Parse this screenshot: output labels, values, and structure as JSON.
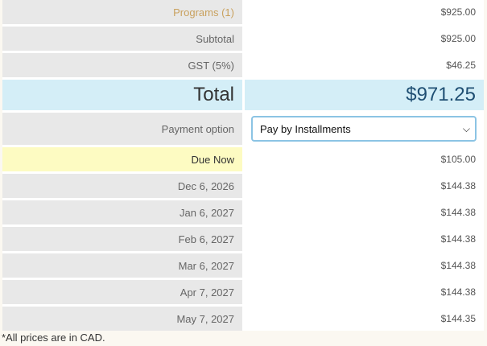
{
  "summary": {
    "programs_label": "Programs (1)",
    "programs_value": "$925.00",
    "subtotal_label": "Subtotal",
    "subtotal_value": "$925.00",
    "gst_label": "GST (5%)",
    "gst_value": "$46.25",
    "total_label": "Total",
    "total_value": "$971.25"
  },
  "payment": {
    "label": "Payment option",
    "selected": "Pay by Installments"
  },
  "schedule": [
    {
      "label": "Due Now",
      "amount": "$105.00"
    },
    {
      "label": "Dec 6, 2026",
      "amount": "$144.38"
    },
    {
      "label": "Jan 6, 2027",
      "amount": "$144.38"
    },
    {
      "label": "Feb 6, 2027",
      "amount": "$144.38"
    },
    {
      "label": "Mar 6, 2027",
      "amount": "$144.38"
    },
    {
      "label": "Apr 7, 2027",
      "amount": "$144.38"
    },
    {
      "label": "May 7, 2027",
      "amount": "$144.35"
    }
  ],
  "footnote": "*All prices are in CAD.",
  "colors": {
    "total_bg": "#d4eef7",
    "total_text": "#1f4f73",
    "due_now_bg": "#fdfbc2",
    "programs_text": "#c9a15e"
  }
}
